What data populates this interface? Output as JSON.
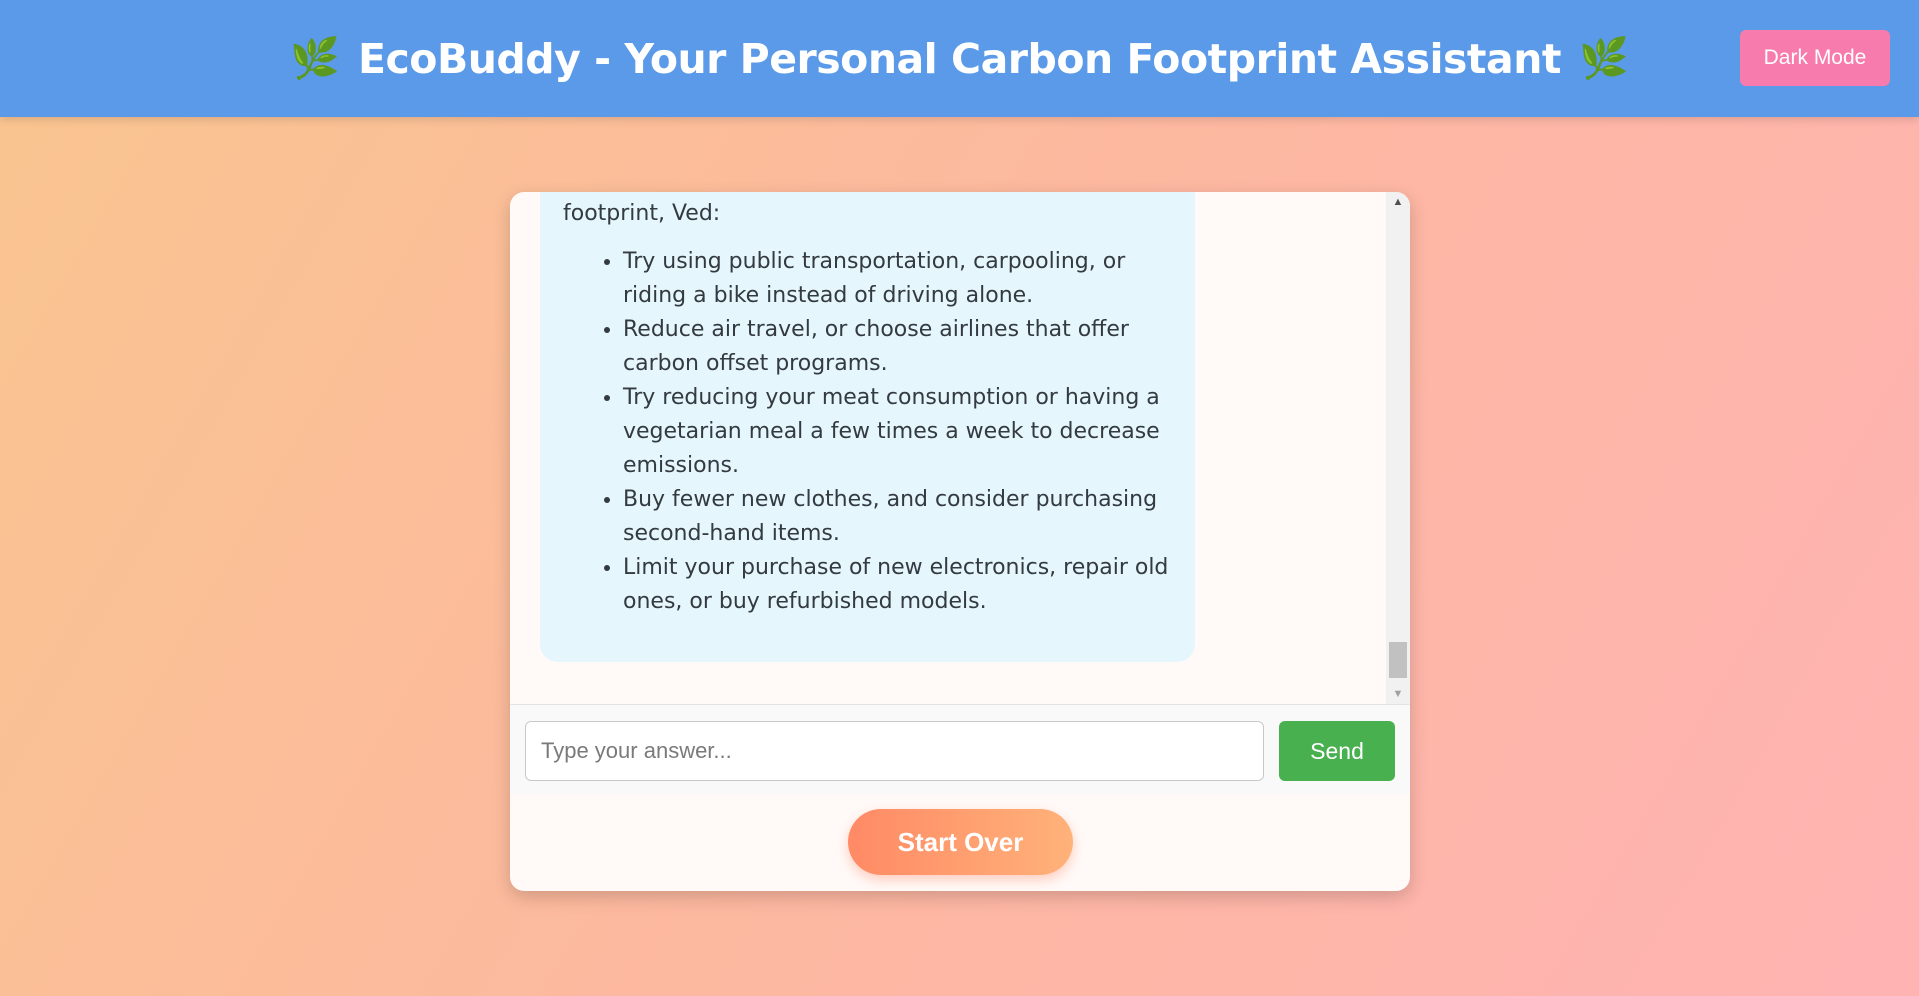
{
  "header": {
    "title": "EcoBuddy - Your Personal Carbon Footprint Assistant",
    "leaf_left": "🌿",
    "leaf_right": "🌿",
    "dark_mode_label": "Dark Mode"
  },
  "chat": {
    "message_intro": "footprint, Ved:",
    "tips": [
      "Try using public transportation, carpooling, or riding a bike instead of driving alone.",
      "Reduce air travel, or choose airlines that offer carbon offset programs.",
      "Try reducing your meat consumption or having a vegetarian meal a few times a week to decrease emissions.",
      "Buy fewer new clothes, and consider purchasing second-hand items.",
      "Limit your purchase of new electronics, repair old ones, or buy refurbished models."
    ]
  },
  "input": {
    "placeholder": "Type your answer...",
    "value": "",
    "send_label": "Send"
  },
  "actions": {
    "start_over_label": "Start Over"
  },
  "icons": {
    "leaf": "leaf-icon",
    "scroll_up": "scroll-up-arrow-icon",
    "scroll_down": "scroll-down-arrow-icon"
  },
  "colors": {
    "header_bg": "#5b9ae8",
    "dark_mode_btn": "#f77bac",
    "bubble_bg": "#e6f6fd",
    "send_btn": "#49b04f",
    "start_over_from": "#ff8a65",
    "start_over_to": "#ffb27a"
  }
}
